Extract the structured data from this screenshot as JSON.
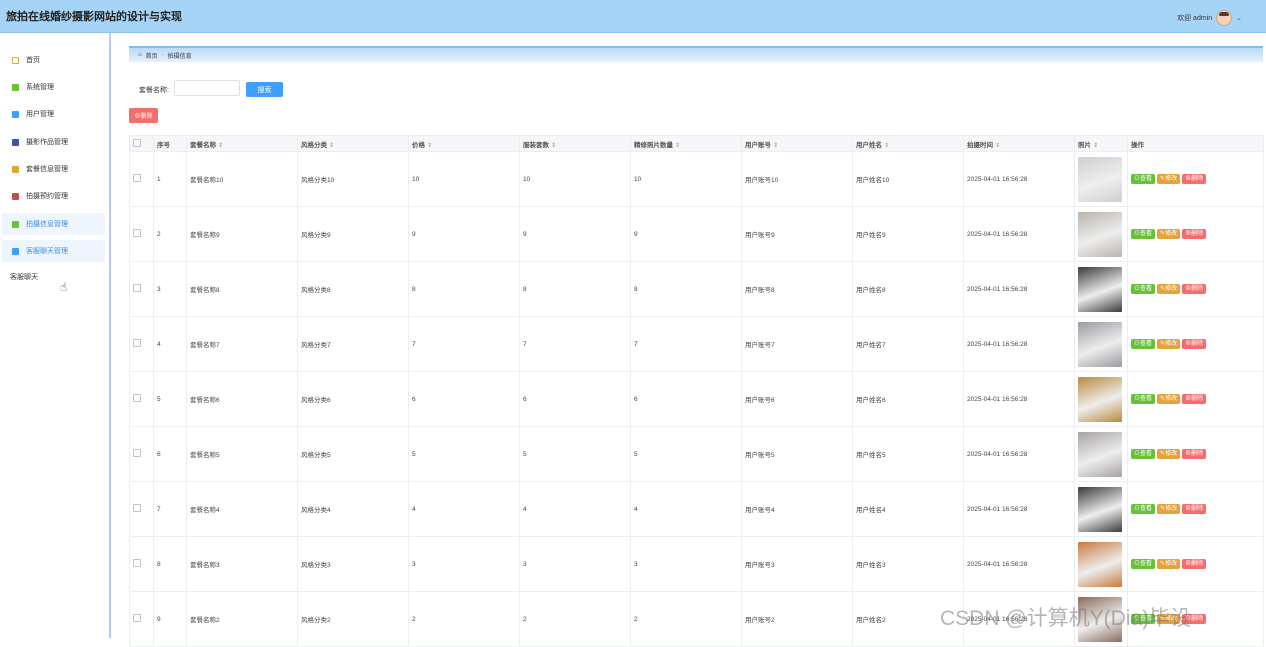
{
  "header": {
    "title": "旅拍在线婚纱摄影网站的设计与实现",
    "welcome": "欢迎 admin"
  },
  "sidebar": {
    "items": [
      {
        "label": "首页",
        "icon": "home-icon",
        "color": "#e6a23c",
        "active": false
      },
      {
        "label": "系统管理",
        "icon": "system-icon",
        "color": "#67c23a",
        "active": false
      },
      {
        "label": "用户管理",
        "icon": "users-icon",
        "color": "#409eff",
        "active": false
      },
      {
        "label": "摄影作品管理",
        "icon": "works-icon",
        "color": "#3f51b5",
        "active": false
      },
      {
        "label": "套餐信息管理",
        "icon": "package-icon",
        "color": "#e6a23c",
        "active": false
      },
      {
        "label": "拍摄预约管理",
        "icon": "booking-icon",
        "color": "#c0504d",
        "active": false
      },
      {
        "label": "拍摄信息管理",
        "icon": "shoot-info-icon",
        "color": "#67c23a",
        "active": true
      },
      {
        "label": "客服聊天管理",
        "icon": "chat-icon",
        "color": "#409eff",
        "active": true
      }
    ],
    "extra": "客服聊天"
  },
  "breadcrumb": {
    "home": "首页",
    "separator": "-",
    "current": "拍摄信息"
  },
  "search": {
    "label": "套餐名称:",
    "value": "",
    "button": "搜索"
  },
  "toolbar": {
    "delete_label": "⊗删除"
  },
  "table": {
    "headers": [
      "序号",
      "套餐名称",
      "风格分类",
      "价格",
      "服装套数",
      "精修照片数量",
      "用户账号",
      "用户姓名",
      "拍摄时间",
      "照片",
      "操作"
    ],
    "rows": [
      {
        "no": "1",
        "name": "套餐名称10",
        "style": "风格分类10",
        "price": "10",
        "outfits": "10",
        "photos": "10",
        "account": "用户账号10",
        "username": "用户姓名10",
        "time": "2025-04-01 16:56:28"
      },
      {
        "no": "2",
        "name": "套餐名称9",
        "style": "风格分类9",
        "price": "9",
        "outfits": "9",
        "photos": "9",
        "account": "用户账号9",
        "username": "用户姓名9",
        "time": "2025-04-01 16:56:28"
      },
      {
        "no": "3",
        "name": "套餐名称8",
        "style": "风格分类8",
        "price": "8",
        "outfits": "8",
        "photos": "8",
        "account": "用户账号8",
        "username": "用户姓名8",
        "time": "2025-04-01 16:56:28"
      },
      {
        "no": "4",
        "name": "套餐名称7",
        "style": "风格分类7",
        "price": "7",
        "outfits": "7",
        "photos": "7",
        "account": "用户账号7",
        "username": "用户姓名7",
        "time": "2025-04-01 16:56:28"
      },
      {
        "no": "5",
        "name": "套餐名称6",
        "style": "风格分类6",
        "price": "6",
        "outfits": "6",
        "photos": "6",
        "account": "用户账号6",
        "username": "用户姓名6",
        "time": "2025-04-01 16:56:28"
      },
      {
        "no": "6",
        "name": "套餐名称5",
        "style": "风格分类5",
        "price": "5",
        "outfits": "5",
        "photos": "5",
        "account": "用户账号5",
        "username": "用户姓名5",
        "time": "2025-04-01 16:56:28"
      },
      {
        "no": "7",
        "name": "套餐名称4",
        "style": "风格分类4",
        "price": "4",
        "outfits": "4",
        "photos": "4",
        "account": "用户账号4",
        "username": "用户姓名4",
        "time": "2025-04-01 16:56:28"
      },
      {
        "no": "8",
        "name": "套餐名称3",
        "style": "风格分类3",
        "price": "3",
        "outfits": "3",
        "photos": "3",
        "account": "用户账号3",
        "username": "用户姓名3",
        "time": "2025-04-01 16:56:28"
      },
      {
        "no": "9",
        "name": "套餐名称2",
        "style": "风格分类2",
        "price": "2",
        "outfits": "2",
        "photos": "2",
        "account": "用户账号2",
        "username": "用户姓名2",
        "time": "2025-04-01 16:56:28"
      }
    ],
    "actions": {
      "view": "查看",
      "edit": "修改",
      "delete": "删除"
    },
    "photo_colors": [
      "#cfcfcf",
      "#b9b3ad",
      "#3a3a3a",
      "#9a9aa0",
      "#b8893b",
      "#a7a2a3",
      "#3d3a38",
      "#c87a3e",
      "#8a6a5a"
    ]
  },
  "watermark": "CSDN @计算机Y(Dia)毕设"
}
